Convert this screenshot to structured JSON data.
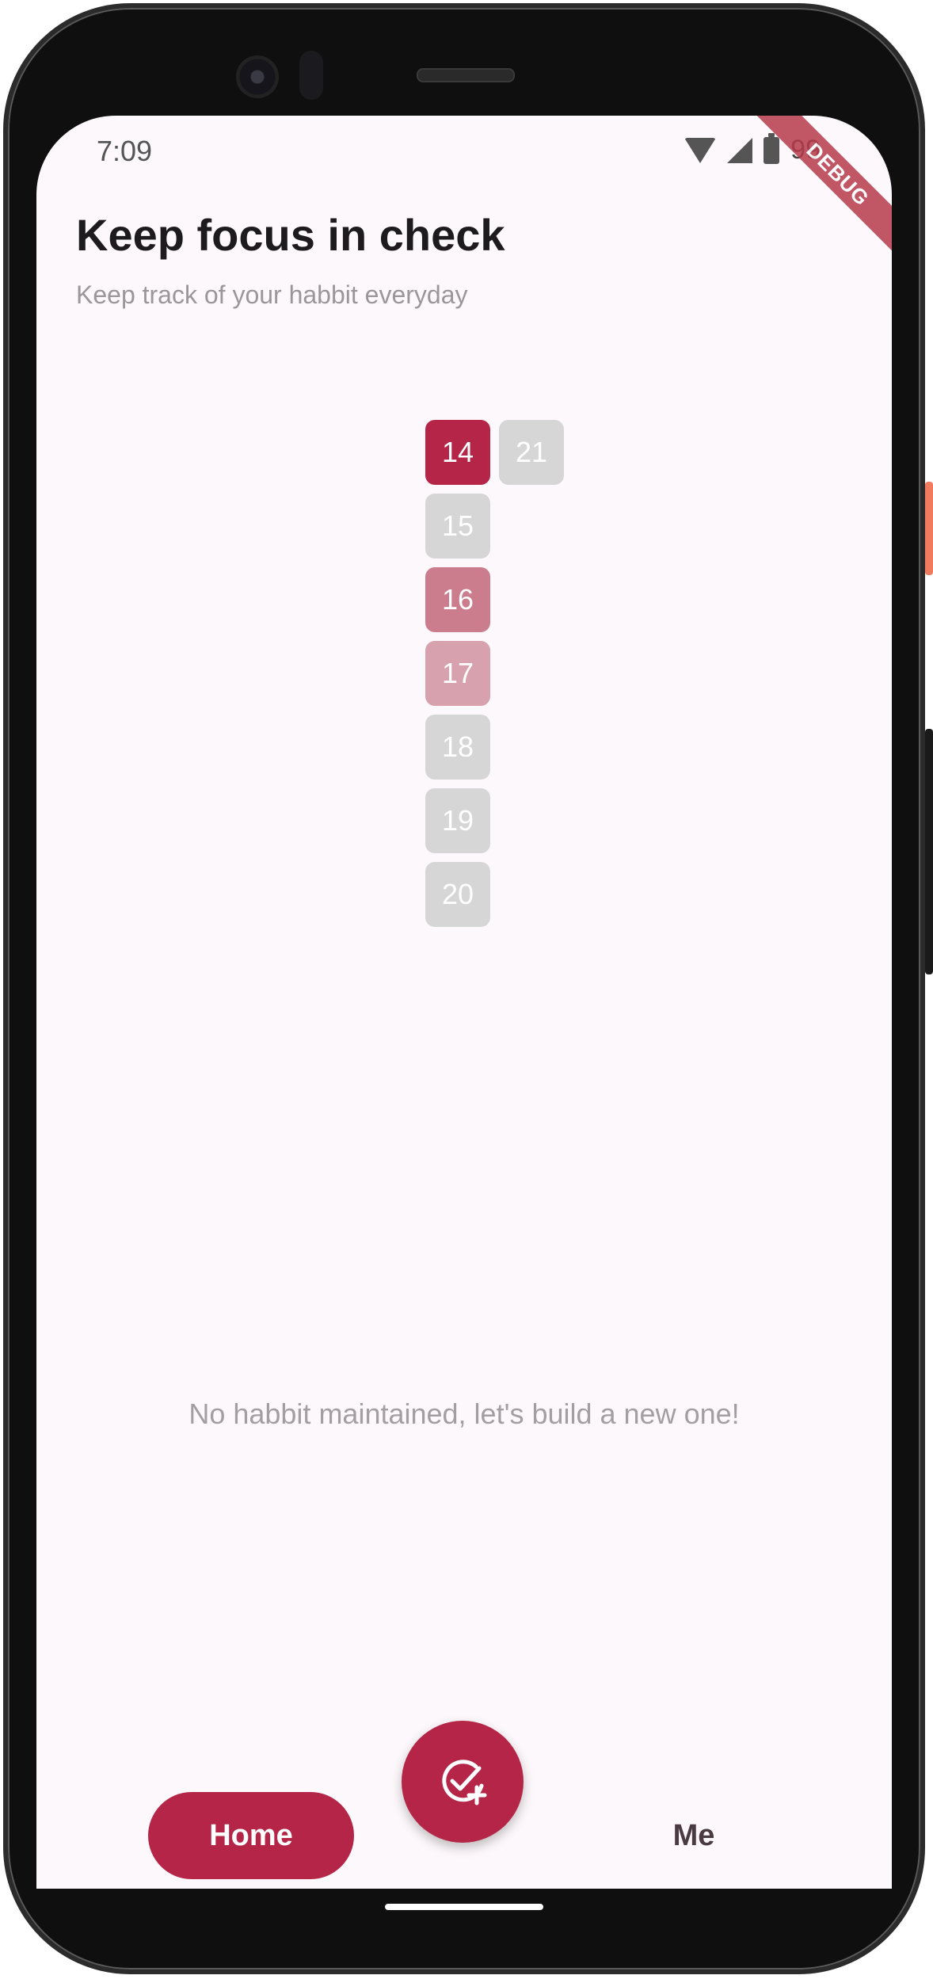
{
  "status_bar": {
    "time": "7:09",
    "battery_text": "99"
  },
  "debug_banner": "DEBUG",
  "header": {
    "title": "Keep focus in check",
    "subtitle": "Keep track of your habbit everyday"
  },
  "calendar": {
    "cells": [
      {
        "day": "14",
        "state": "full",
        "color": "#b52547"
      },
      {
        "day": "15",
        "state": "empty",
        "color": "#d6d6d6"
      },
      {
        "day": "16",
        "state": "medium",
        "color": "#cb7d8e"
      },
      {
        "day": "17",
        "state": "light",
        "color": "#d7a2ad"
      },
      {
        "day": "18",
        "state": "empty",
        "color": "#d6d6d6"
      },
      {
        "day": "19",
        "state": "empty",
        "color": "#d6d6d6"
      },
      {
        "day": "20",
        "state": "empty",
        "color": "#d6d6d6"
      },
      {
        "day": "21",
        "state": "empty",
        "color": "#d6d6d6"
      }
    ]
  },
  "empty_state": {
    "message": "No habbit maintained, let's build a new one!"
  },
  "fab": {
    "icon": "add-check-icon",
    "color": "#b52547"
  },
  "nav": {
    "home_label": "Home",
    "me_label": "Me"
  },
  "colors": {
    "accent": "#b52547",
    "background": "#fdf8fb"
  }
}
